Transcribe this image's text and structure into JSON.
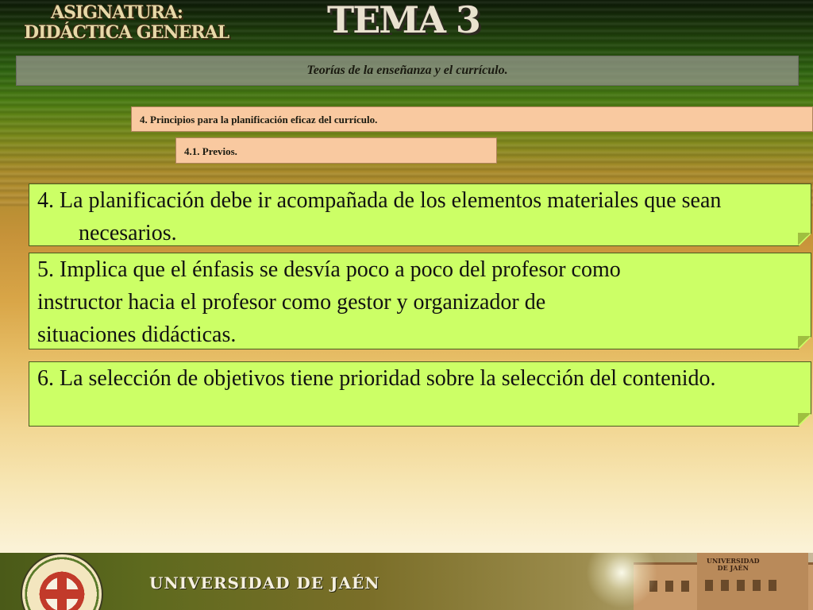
{
  "header": {
    "course_line1": "ASIGNATURA:",
    "course_line2": "DIDÁCTICA GENERAL",
    "tema": "TEMA 3"
  },
  "topic": "Teorías de la enseñanza y el currículo.",
  "section": "4. Principios para la planificación eficaz del currículo.",
  "subsection": "4.1. Previos.",
  "notes": [
    {
      "lines": [
        "4. La planificación debe ir acompañada de los elementos materiales que sean necesarios."
      ]
    },
    {
      "lines": [
        "5. Implica que el énfasis se desvía poco a poco del profesor como",
        "instructor hacia el profesor como gestor y organizador de",
        "situaciones didácticas."
      ]
    },
    {
      "lines": [
        "6. La selección de objetivos tiene prioridad sobre la selección del contenido."
      ]
    }
  ],
  "footer": {
    "university": "UNIVERSIDAD DE JAÉN",
    "seal_icon": "university-seal-icon",
    "building_sign_line1": "UNIVERSIDAD",
    "building_sign_line2": "DE JAÉN"
  },
  "colors": {
    "note_bg": "#ccff66",
    "section_bg": "#f9c9a0",
    "topic_bg": "#96968c"
  }
}
